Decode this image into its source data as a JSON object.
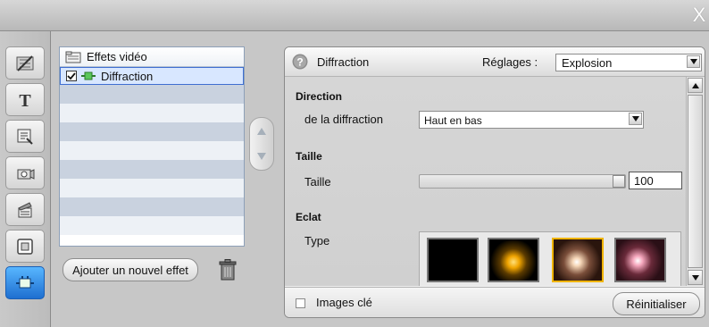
{
  "window": {
    "close_glyph": "X"
  },
  "left_tabs": [
    {
      "icon": "edit-video-icon",
      "active": false
    },
    {
      "icon": "title-t-icon",
      "active": false
    },
    {
      "icon": "menu-icon",
      "active": false
    },
    {
      "icon": "camera-icon",
      "active": false
    },
    {
      "icon": "clapper-icon",
      "active": false
    },
    {
      "icon": "frame-icon",
      "active": false
    },
    {
      "icon": "effects-plug-icon",
      "active": true
    }
  ],
  "effects_list": {
    "header": "Effets vidéo",
    "items": [
      {
        "label": "Diffraction",
        "checked": true,
        "selected": true
      }
    ]
  },
  "add_effect_button": "Ajouter un nouvel effet",
  "effect_panel": {
    "title": "Diffraction",
    "preset_label": "Réglages :",
    "preset_value": "Explosion",
    "sections": {
      "direction": {
        "heading": "Direction",
        "label": "de la diffraction",
        "value": "Haut en bas"
      },
      "taille": {
        "heading": "Taille",
        "label": "Taille",
        "slider_fraction": 1.0,
        "value": "100"
      },
      "eclat": {
        "heading": "Eclat",
        "label": "Type"
      }
    },
    "keyframes_label": "Images clé",
    "reset_button": "Réinitialiser"
  },
  "colors": {
    "accent_blue": "#2a7fe0",
    "selected_gold": "#f0b400"
  }
}
